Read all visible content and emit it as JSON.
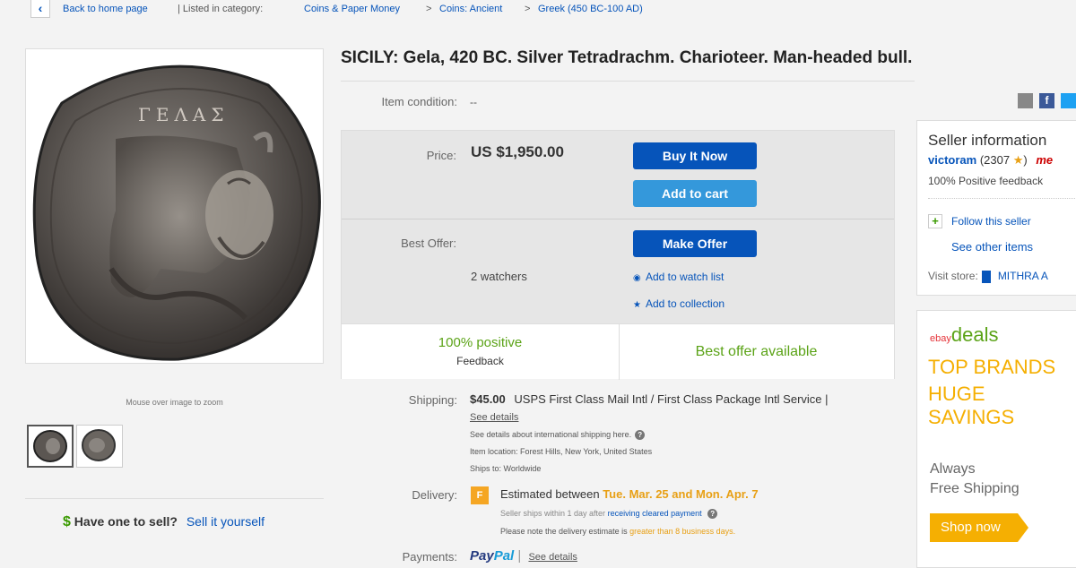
{
  "breadcrumb": {
    "back_icon": "chevron-left-icon",
    "back_label": "Back to home page",
    "listed_label": "| Listed in category:",
    "items": [
      "Coins & Paper Money",
      "Coins: Ancient",
      "Greek (450 BC-100 AD)"
    ],
    "separator": ">"
  },
  "gallery": {
    "main_image": "silver-tetradrachm-coin-image",
    "coin_inscription": "ΓΕΛΑΣ",
    "zoom_hint": "Mouse over image to zoom",
    "thumbnails": [
      "coin-obverse-thumbnail",
      "coin-reverse-thumbnail"
    ]
  },
  "sell_promo": {
    "icon": "dollar-sign-icon",
    "question": "Have one to sell?",
    "link": "Sell it yourself"
  },
  "item": {
    "title": "SICILY: Gela, 420 BC. Silver Tetradrachm. Charioteer. Man-headed bull.",
    "condition_label": "Item condition:",
    "condition_value": "--",
    "share_icons": [
      "email-icon",
      "facebook-icon",
      "twitter-icon"
    ]
  },
  "buy_box": {
    "price_label": "Price:",
    "price_value": "US $1,950.00",
    "buy_now": "Buy It Now",
    "add_to_cart": "Add to cart",
    "best_offer_label": "Best Offer:",
    "make_offer": "Make Offer",
    "watchers": "2 watchers",
    "watch_list": "Add to watch list",
    "collection": "Add to collection",
    "feedback_percent": "100% positive",
    "feedback_label": "Feedback",
    "best_offer_available": "Best offer available"
  },
  "shipping": {
    "label": "Shipping:",
    "cost": "$45.00",
    "service": "USPS First Class Mail Intl / First Class Package Intl Service |",
    "see_details": "See details",
    "intl_details": "See details about international shipping here.",
    "location": "Item location: Forest Hills, New York, United States",
    "ships_to": "Ships to: Worldwide"
  },
  "delivery": {
    "label": "Delivery:",
    "icon": "delivery-badge-icon",
    "prefix": "Estimated between",
    "dates": "Tue. Mar. 25 and Mon. Apr. 7",
    "ships_within": "Seller ships within 1 day after",
    "cleared": "receiving cleared payment",
    "note_prefix": "Please note the delivery estimate is",
    "note_highlight": "greater than 8 business days."
  },
  "payments": {
    "label": "Payments:",
    "paypal_1": "Pay",
    "paypal_2": "Pal",
    "see_details": "See details"
  },
  "seller": {
    "heading": "Seller information",
    "name": "victoram",
    "score": "(2307",
    "star": "★",
    "score_close": ")",
    "me_badge": "me",
    "positive": "100% Positive feedback",
    "follow": "Follow this seller",
    "other_items": "See other items",
    "visit_label": "Visit store:",
    "store_name": "MITHRA A"
  },
  "ad": {
    "ebay_text": "ebay",
    "deals_text": "deals",
    "line1": "TOP BRANDS",
    "line2": "HUGE",
    "line3": "SAVINGS",
    "line4": "Always",
    "line5": "Free Shipping",
    "cta": "Shop now"
  },
  "colors": {
    "accent_blue": "#0654ba",
    "light_blue": "#3498db",
    "positive_green": "#5ba317",
    "deals_yellow": "#f5af02"
  }
}
